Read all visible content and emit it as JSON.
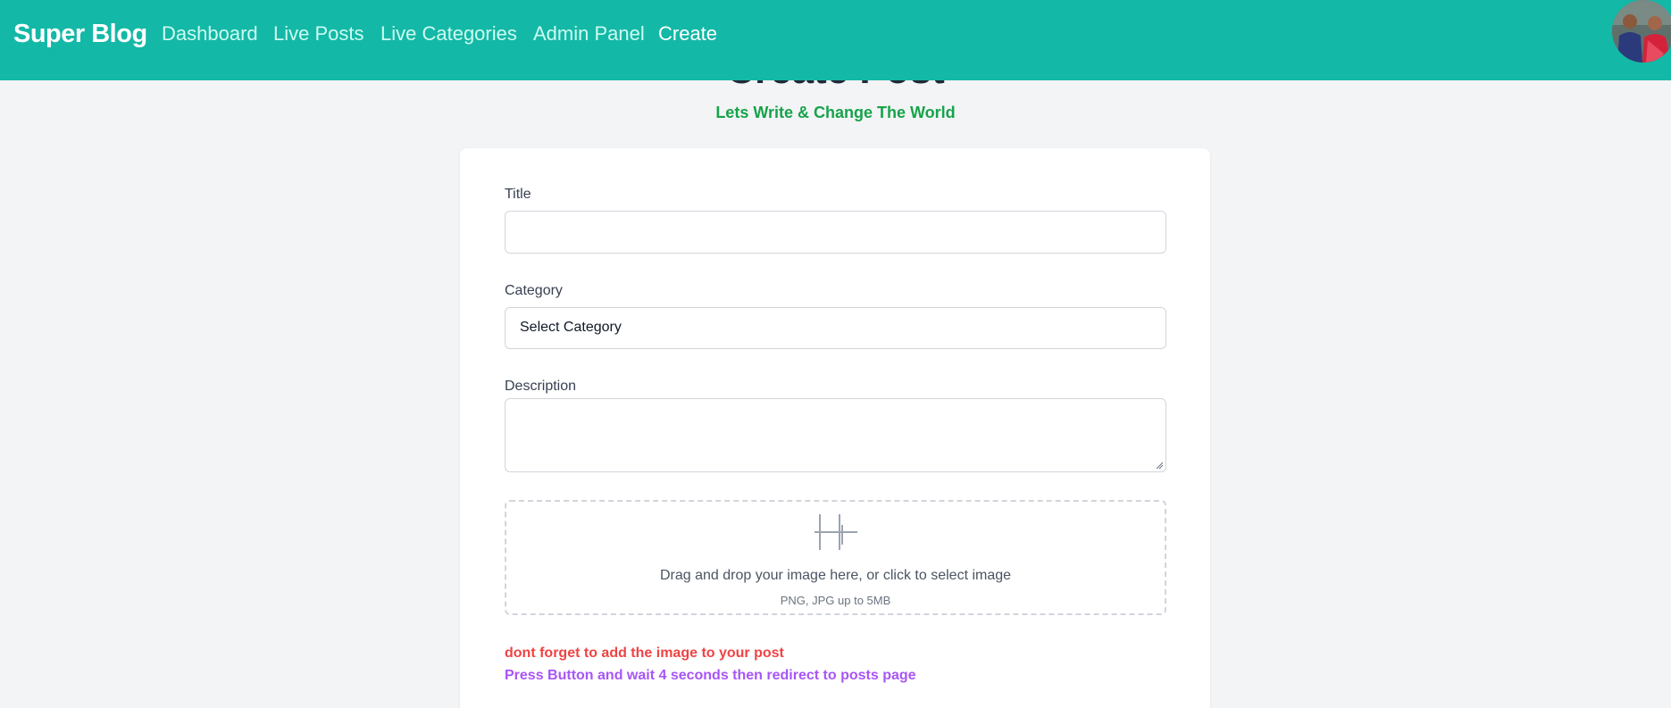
{
  "navbar": {
    "brand": "Super Blog",
    "links": [
      {
        "label": "Dashboard",
        "active": false
      },
      {
        "label": "Live Posts",
        "active": false
      },
      {
        "label": "Live Categories",
        "active": false
      },
      {
        "label": "Admin Panel",
        "active": false
      },
      {
        "label": "Create",
        "active": true
      }
    ],
    "avatar_icon": "user-avatar",
    "background": "#14b8a6"
  },
  "header": {
    "title": "Create Post",
    "subtitle": "Lets Write & Change The World"
  },
  "form": {
    "title_label": "Title",
    "title_value": "",
    "category_label": "Category",
    "category_selected": "Select Category",
    "description_label": "Description",
    "description_value": "",
    "dropzone": {
      "icon": "image-upload-icon",
      "text": "Drag and drop your image here, or click to select image",
      "hint": "PNG, JPG up to 5MB"
    },
    "warning_image": "dont forget to add the image to your post",
    "info_redirect": "Press Button and wait 4 seconds then redirect to posts page"
  },
  "colors": {
    "accent": "#14b8a6",
    "subtitle_green": "#16a34a",
    "warning_red": "#ef4444",
    "info_purple": "#a855f7"
  }
}
